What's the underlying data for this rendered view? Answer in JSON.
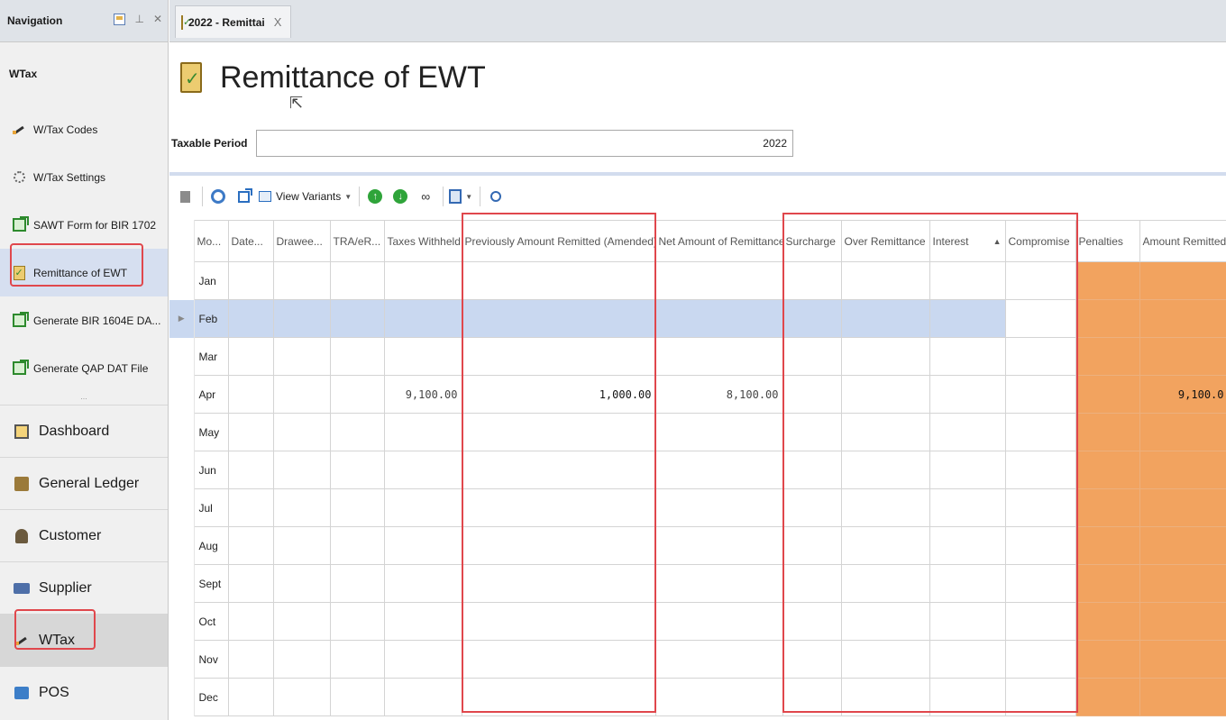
{
  "navigation": {
    "header": "Navigation",
    "module_title": "WTax",
    "sub_items": [
      {
        "label": "W/Tax Codes",
        "icon": "pen-icon"
      },
      {
        "label": "W/Tax Settings",
        "icon": "gear-icon"
      },
      {
        "label": "SAWT Form for BIR 1702",
        "icon": "export-icon"
      },
      {
        "label": "Remittance of EWT",
        "icon": "clipboard-check-icon"
      },
      {
        "label": "Generate BIR 1604E DA...",
        "icon": "export-icon"
      },
      {
        "label": "Generate QAP DAT File",
        "icon": "export-icon"
      }
    ],
    "more_dots": "...",
    "main_items": [
      {
        "label": "Dashboard",
        "icon": "dashboard-icon"
      },
      {
        "label": "General Ledger",
        "icon": "ledger-icon"
      },
      {
        "label": "Customer",
        "icon": "customer-icon"
      },
      {
        "label": "Supplier",
        "icon": "supplier-icon"
      },
      {
        "label": "WTax",
        "icon": "pen-icon"
      },
      {
        "label": "POS",
        "icon": "pos-icon"
      }
    ]
  },
  "tab": {
    "label": "2022 - Remittai",
    "close": "X"
  },
  "page": {
    "title": "Remittance of EWT"
  },
  "period": {
    "label": "Taxable Period",
    "value": "2022"
  },
  "toolbar": {
    "view_variants": "View Variants"
  },
  "grid": {
    "columns": [
      "Mo...",
      "Date...",
      "Drawee...",
      "TRA/eR...",
      "Taxes Withheld",
      "Previously Amount Remitted (Amended)",
      "Net Amount of Remittance",
      "Surcharge",
      "Over Remittance",
      "Interest",
      "Compromise",
      "Penalties",
      "Amount Remitted"
    ],
    "rows": [
      {
        "month": "Jan",
        "taxes_withheld": "",
        "prev_amount": "",
        "net_amount": "",
        "amount_remitted": ""
      },
      {
        "month": "Feb",
        "taxes_withheld": "",
        "prev_amount": "",
        "net_amount": "",
        "amount_remitted": ""
      },
      {
        "month": "Mar",
        "taxes_withheld": "",
        "prev_amount": "",
        "net_amount": "",
        "amount_remitted": ""
      },
      {
        "month": "Apr",
        "taxes_withheld": "9,100.00",
        "prev_amount": "1,000.00",
        "net_amount": "8,100.00",
        "amount_remitted": "9,100.0"
      },
      {
        "month": "May",
        "taxes_withheld": "",
        "prev_amount": "",
        "net_amount": "",
        "amount_remitted": ""
      },
      {
        "month": "Jun",
        "taxes_withheld": "",
        "prev_amount": "",
        "net_amount": "",
        "amount_remitted": ""
      },
      {
        "month": "Jul",
        "taxes_withheld": "",
        "prev_amount": "",
        "net_amount": "",
        "amount_remitted": ""
      },
      {
        "month": "Aug",
        "taxes_withheld": "",
        "prev_amount": "",
        "net_amount": "",
        "amount_remitted": ""
      },
      {
        "month": "Sept",
        "taxes_withheld": "",
        "prev_amount": "",
        "net_amount": "",
        "amount_remitted": ""
      },
      {
        "month": "Oct",
        "taxes_withheld": "",
        "prev_amount": "",
        "net_amount": "",
        "amount_remitted": ""
      },
      {
        "month": "Nov",
        "taxes_withheld": "",
        "prev_amount": "",
        "net_amount": "",
        "amount_remitted": ""
      },
      {
        "month": "Dec",
        "taxes_withheld": "",
        "prev_amount": "",
        "net_amount": "",
        "amount_remitted": ""
      }
    ],
    "selected_month": "Feb"
  },
  "colors": {
    "highlight": "#e0474c",
    "orange_columns": "#f2a35f",
    "selected_row": "#c9d8f0"
  }
}
